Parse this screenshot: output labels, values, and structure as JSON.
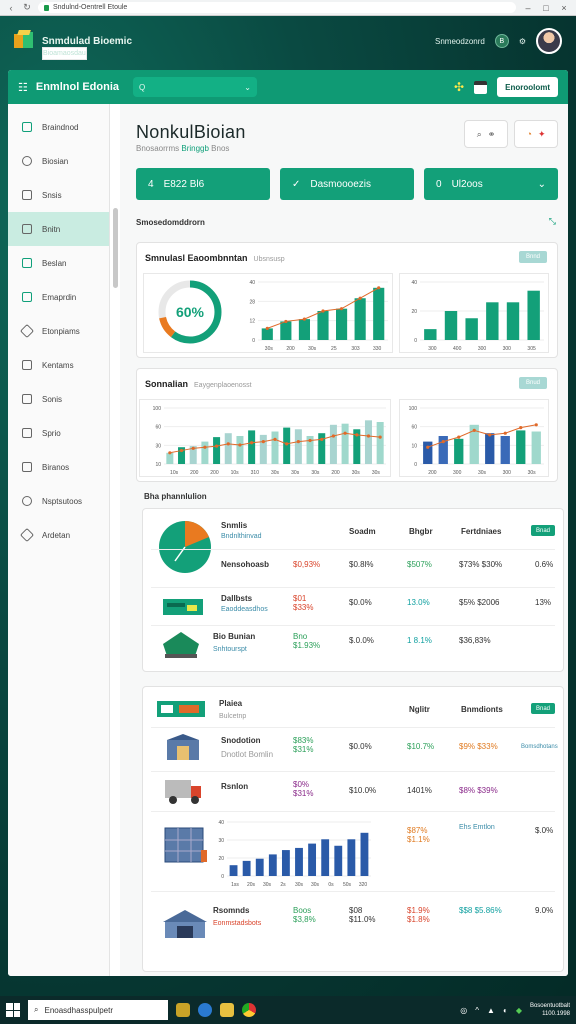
{
  "browser": {
    "url": "Sndulnd-Oentrell Etoule"
  },
  "brand": {
    "name": "Snmdulad Bioemic",
    "tagline": "Bioamaosdau",
    "user_label": "Snmeodzonrd",
    "user_badge": "B"
  },
  "topbar": {
    "app_name": "Enmlnol Edonia",
    "search_placeholder": "Q",
    "button_label": "Enoroolomt"
  },
  "sidebar": {
    "items": [
      {
        "label": "Braindnod"
      },
      {
        "label": "Biosian"
      },
      {
        "label": "Snsis"
      },
      {
        "label": "Bnitn"
      },
      {
        "label": "Beslan"
      },
      {
        "label": "Emaprdin"
      },
      {
        "label": "Etonpiams"
      },
      {
        "label": "Kentams"
      },
      {
        "label": "Sonis"
      },
      {
        "label": "Sprio"
      },
      {
        "label": "Biranos"
      },
      {
        "label": "Nsptsutoos"
      },
      {
        "label": "Ardetan"
      }
    ]
  },
  "page": {
    "title": "NonkulBioian",
    "subtitle_prefix": "Bnosaorrms",
    "subtitle_link": "Bringgb",
    "subtitle_suffix": "Bnos"
  },
  "pills": [
    {
      "icon": "4",
      "label": "E822 Bl6"
    },
    {
      "icon": "✓",
      "label": "Dasmoooezis"
    },
    {
      "icon": "0",
      "label": "Ul2oos"
    }
  ],
  "section1": {
    "label": "Smosedomddrorn"
  },
  "card1": {
    "title": "Smnulasl Eaoombnntan",
    "hint": "Ubsnsusp",
    "tag": "Bnnd",
    "donut_label": "60%"
  },
  "card2": {
    "title": "Sonnalian",
    "hint": "Eaygenplaoenosst",
    "tag": "Bnud"
  },
  "section2": {
    "label": "Bha phannlulion"
  },
  "table1": {
    "headers": [
      "Soadm",
      "Bhgbr",
      "Fertdniaes",
      "Bnad"
    ],
    "rows": [
      {
        "name": "Snmlis",
        "desc": "Bndnlthinvad",
        "v1": "",
        "v2": "",
        "v3": "",
        "v4": "",
        "v5": ""
      },
      {
        "name": "Nensohoasb",
        "desc": "",
        "v1": "$0,93%",
        "v2": "$0.8l%",
        "v3": "$507%",
        "v4": "$73% $30%",
        "v5": "0.6%"
      },
      {
        "name": "Dallbsts",
        "desc": "Eaoddeasdhos",
        "v1": "$01 $33%",
        "v2": "$0.0%",
        "v3": "13.0%",
        "v4": "$5% $2006",
        "v5": "13%"
      },
      {
        "name": "Bio Bunian",
        "desc": "Snhtourspt",
        "v1": "Bno $1.93%",
        "v2": "$.0.0%",
        "v3": "1 8.1%",
        "v4": "$36,83%",
        "v5": ""
      }
    ]
  },
  "table2": {
    "title": "Plaiea",
    "desc": "Bulcetnp",
    "headers": [
      "Nglitr",
      "Bnmdionts",
      "Bnad"
    ],
    "rows": [
      {
        "name": "Snodotion",
        "desc": "Dnotlot Bomlin",
        "v1": "$83% $31%",
        "v2": "$0.0%",
        "v3": "$10.7%",
        "v4": "$9% $33%",
        "v5": "Bomsdhotans"
      },
      {
        "name": "Rsnlon",
        "desc": "",
        "v1": "$0% $31%",
        "v2": "$10.0%",
        "v3": "1401%",
        "v4": "$8% $39%",
        "v5": ""
      },
      {
        "name": "",
        "desc": "",
        "v1": "$87% $1.1%",
        "v2": "",
        "v3": "",
        "v4": "Ehs Emtlon",
        "v5": "$.0%"
      },
      {
        "name": "Rsomnds",
        "desc": "Eonmstadsbots",
        "v1": "Boos $3,8%",
        "v2": "$08 $11.0%",
        "v3": "$1.9% $1.8%",
        "v4": "$$8 $5.86%",
        "v5": "9.0%"
      }
    ]
  },
  "chart_data": [
    {
      "type": "line",
      "title": "",
      "x": [
        1,
        2,
        3,
        4,
        5,
        6,
        7
      ],
      "values": [
        10,
        16,
        18,
        25,
        27,
        36,
        45
      ],
      "ylim": [
        0,
        50
      ],
      "yticks": [
        "40",
        "28",
        "12",
        "0"
      ],
      "xticks": [
        "30s",
        "200",
        "30s",
        "25",
        "303",
        "330"
      ]
    },
    {
      "type": "bar",
      "title": "",
      "categories": [
        "1",
        "2",
        "3",
        "4",
        "5",
        "6"
      ],
      "values": [
        15,
        40,
        30,
        52,
        52,
        68
      ],
      "ylim": [
        0,
        80
      ],
      "yticks": [
        "40",
        "20",
        "0"
      ],
      "xticks": [
        "300",
        "400",
        "300",
        "300",
        "305"
      ]
    },
    {
      "type": "bar",
      "title": "",
      "categories": [
        "1",
        "2",
        "3",
        "4",
        "5",
        "6",
        "7",
        "8",
        "9",
        "10",
        "11",
        "12",
        "13",
        "14",
        "15",
        "16",
        "17",
        "18",
        "19"
      ],
      "values": [
        20,
        30,
        32,
        40,
        48,
        55,
        50,
        60,
        52,
        58,
        65,
        62,
        50,
        55,
        70,
        72,
        62,
        78,
        75
      ],
      "line": [
        20,
        24,
        28,
        30,
        32,
        36,
        34,
        38,
        40,
        44,
        36,
        40,
        42,
        44,
        50,
        55,
        52,
        50,
        48
      ],
      "ylim": [
        0,
        100
      ],
      "yticks": [
        "100",
        "60",
        "30",
        "10"
      ],
      "xticks": [
        "10s",
        "200",
        "200",
        "10s",
        "310",
        "30s",
        "30s",
        "30s",
        "200",
        "30s",
        "30s"
      ]
    },
    {
      "type": "bar",
      "title": "",
      "categories": [
        "1",
        "2",
        "3",
        "4",
        "5",
        "6",
        "7",
        "8"
      ],
      "values": [
        40,
        50,
        45,
        70,
        55,
        50,
        60,
        58
      ],
      "line": [
        30,
        40,
        48,
        60,
        52,
        55,
        65,
        70
      ],
      "ylim": [
        0,
        100
      ],
      "yticks": [
        "100",
        "60",
        "10",
        "0"
      ],
      "xticks": [
        "200",
        "300",
        "30s",
        "300",
        "30s"
      ]
    },
    {
      "type": "bar",
      "title": "",
      "categories": [
        "1",
        "2",
        "3",
        "4",
        "5",
        "6",
        "7",
        "8",
        "9",
        "10",
        "11"
      ],
      "values": [
        10,
        14,
        16,
        20,
        24,
        26,
        30,
        34,
        28,
        34,
        40
      ],
      "ylim": [
        0,
        50
      ],
      "yticks": [
        "40",
        "30",
        "20",
        "0"
      ],
      "xticks": [
        "1ss",
        "20s",
        "30s",
        "2s",
        "30s",
        "30s",
        "0s",
        "50s",
        "320"
      ]
    }
  ],
  "taskbar": {
    "search_placeholder": "Enoasdhasspulpetr",
    "tray_text": "Bosoentuotbalt",
    "time": "1100.1998"
  }
}
